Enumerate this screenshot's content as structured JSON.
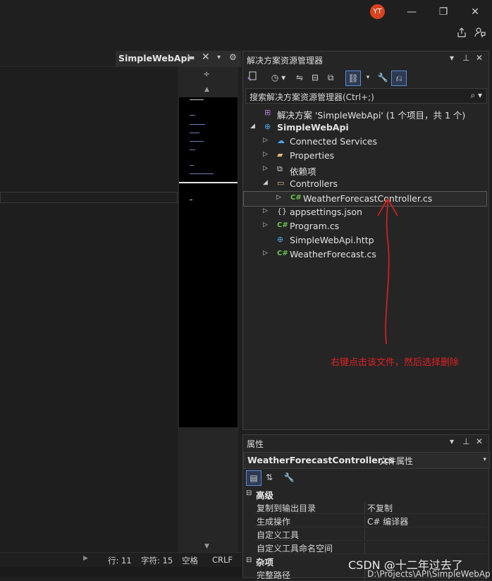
{
  "titlebar": {
    "avatar_initials": "YT",
    "minimize": "—",
    "restore": "❐",
    "close": "✕",
    "share_icon": "share-icon",
    "feedback_icon": "feedback-icon"
  },
  "editor": {
    "tab_title": "SimpleWebApi",
    "tab_pin": "▬",
    "tab_close": "✕",
    "tab_dropdown": "▾",
    "tab_settings": "⚙",
    "splitter": "÷",
    "status": {
      "line": "行: 11",
      "char": "字符: 15",
      "indent": "空格",
      "eol": "CRLF"
    }
  },
  "solution_explorer": {
    "title": "解决方案资源管理器",
    "dropdown": "▾",
    "pin": "⊥",
    "close": "✕",
    "search_placeholder": "搜索解决方案资源管理器(Ctrl+;)",
    "search_icon": "⌕",
    "tree": [
      {
        "label": "解决方案 'SimpleWebApi' (1 个项目，共 1 个)",
        "icon": "solution-icon",
        "depth": 0,
        "chevron": ""
      },
      {
        "label": "SimpleWebApi",
        "icon": "web-project-icon",
        "depth": 0,
        "chevron": "◢",
        "bold": true
      },
      {
        "label": "Connected Services",
        "icon": "connected-services-icon",
        "depth": 1,
        "chevron": "▷"
      },
      {
        "label": "Properties",
        "icon": "properties-folder-icon",
        "depth": 1,
        "chevron": "▷"
      },
      {
        "label": "依赖项",
        "icon": "dependencies-icon",
        "depth": 1,
        "chevron": "▷"
      },
      {
        "label": "Controllers",
        "icon": "folder-icon",
        "depth": 1,
        "chevron": "◢"
      },
      {
        "label": "WeatherForecastController.cs",
        "icon": "csharp-file-icon",
        "depth": 2,
        "chevron": "▷",
        "selected": true
      },
      {
        "label": "appsettings.json",
        "icon": "json-file-icon",
        "depth": 1,
        "chevron": "▷"
      },
      {
        "label": "Program.cs",
        "icon": "csharp-file-icon",
        "depth": 1,
        "chevron": "▷"
      },
      {
        "label": "SimpleWebApi.http",
        "icon": "http-file-icon",
        "depth": 1,
        "chevron": ""
      },
      {
        "label": "WeatherForecast.cs",
        "icon": "csharp-file-icon",
        "depth": 1,
        "chevron": "▷"
      }
    ]
  },
  "annotation": {
    "text": "右键点击该文件，然后选择删除",
    "color": "#e02020"
  },
  "properties": {
    "title": "属性",
    "dropdown": "▾",
    "pin": "⊥",
    "close": "✕",
    "object_name": "WeatherForecastController.cs",
    "object_kind": "文件属性",
    "categories": [
      {
        "name": "高级",
        "rows": [
          {
            "name": "复制到输出目录",
            "value": "不复制"
          },
          {
            "name": "生成操作",
            "value": "C# 编译器"
          },
          {
            "name": "自定义工具",
            "value": ""
          },
          {
            "name": "自定义工具命名空间",
            "value": ""
          }
        ]
      },
      {
        "name": "杂项",
        "rows": [
          {
            "name": "完整路径",
            "value": "D:\\Projects\\API\\SimpleWebAp"
          }
        ]
      }
    ]
  },
  "watermark": "CSDN @十二年过去了"
}
